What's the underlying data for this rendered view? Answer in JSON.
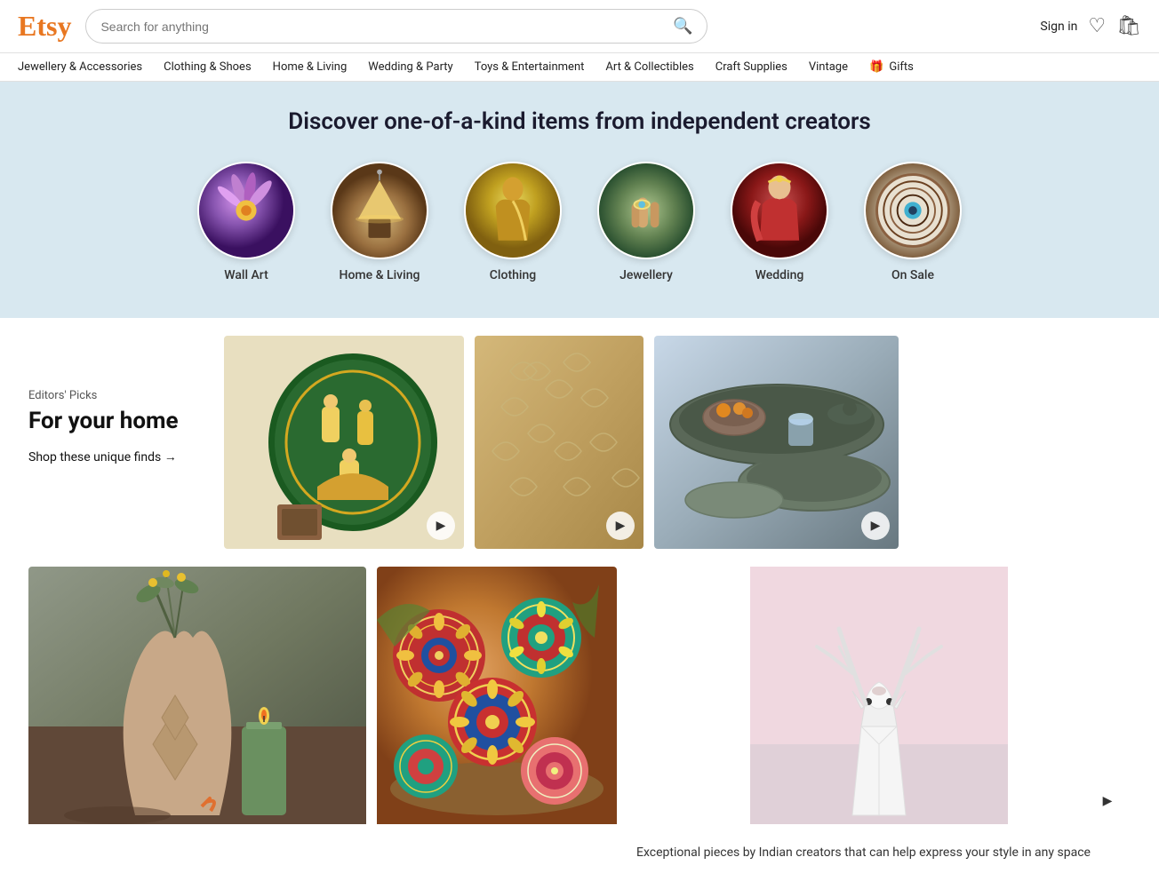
{
  "header": {
    "logo": "Etsy",
    "search_placeholder": "Search for anything",
    "sign_in": "Sign in",
    "wishlist_icon": "♡",
    "cart_icon": "🛍"
  },
  "nav": {
    "items": [
      {
        "label": "Jewellery & Accessories"
      },
      {
        "label": "Clothing & Shoes"
      },
      {
        "label": "Home & Living"
      },
      {
        "label": "Wedding & Party"
      },
      {
        "label": "Toys & Entertainment"
      },
      {
        "label": "Art & Collectibles"
      },
      {
        "label": "Craft Supplies"
      },
      {
        "label": "Vintage"
      },
      {
        "label": "Gifts"
      }
    ]
  },
  "hero": {
    "title": "Discover one-of-a-kind items from independent creators"
  },
  "categories": [
    {
      "label": "Wall Art",
      "emoji": "🌸",
      "class": "cat-purple"
    },
    {
      "label": "Home & Living",
      "emoji": "🏮",
      "class": "cat-lamp"
    },
    {
      "label": "Clothing",
      "emoji": "👗",
      "class": "cat-yellow"
    },
    {
      "label": "Jewellery",
      "emoji": "💍",
      "class": "cat-ring"
    },
    {
      "label": "Wedding",
      "emoji": "👰",
      "class": "cat-red"
    },
    {
      "label": "On Sale",
      "emoji": "🎯",
      "class": "cat-plate"
    }
  ],
  "editors": {
    "label": "Editors' Picks",
    "title": "For your home",
    "shop_link": "Shop these unique finds →"
  },
  "side_text": {
    "description": "Exceptional pieces by Indian creators that can help express your style in any space"
  }
}
